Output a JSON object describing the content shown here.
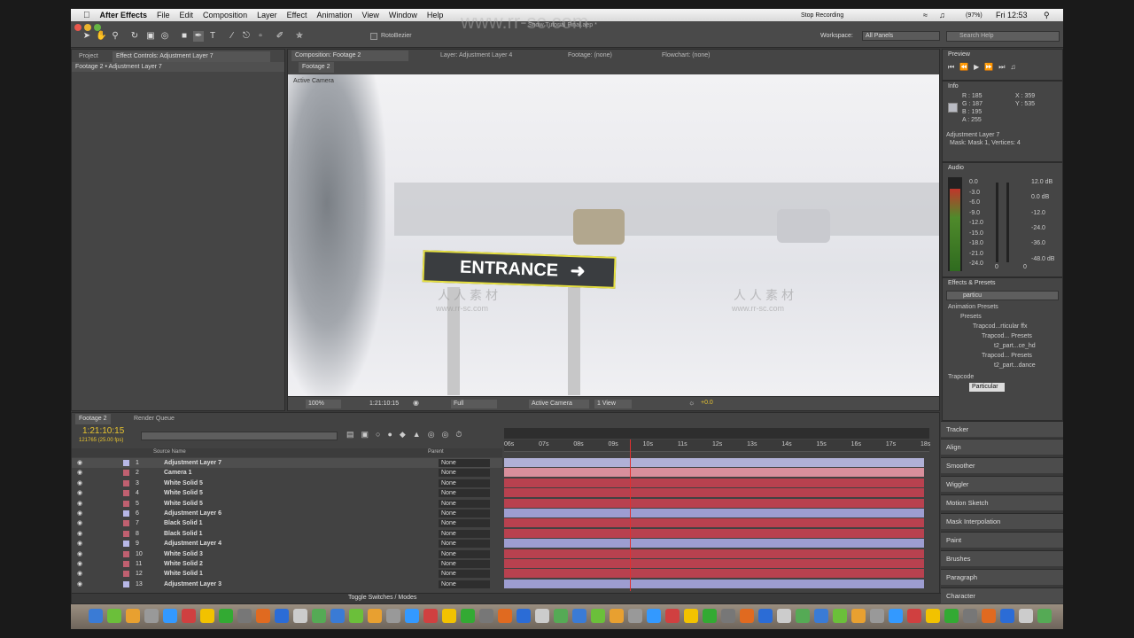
{
  "menubar": {
    "app": "After Effects",
    "items": [
      "File",
      "Edit",
      "Composition",
      "Layer",
      "Effect",
      "Animation",
      "View",
      "Window",
      "Help"
    ],
    "recording": "Stop Recording",
    "battery": "(97%)",
    "time": "Fri 12:53"
  },
  "window_title": "Snow Tutorial Final.aep *",
  "toolbar": {
    "rotobezier": "RotoBezier",
    "workspace_label": "Workspace:",
    "workspace_value": "All Panels",
    "search_placeholder": "Search Help"
  },
  "left_panel": {
    "tab_project": "Project",
    "tab_effect_controls": "Effect Controls: Adjustment Layer 7",
    "breadcrumb": "Footage 2 • Adjustment Layer 7"
  },
  "viewer": {
    "tab_composition": "Composition: Footage 2",
    "tab_layer": "Layer: Adjustment Layer 4",
    "tab_footage": "Footage: (none)",
    "tab_flowchart": "Flowchart: (none)",
    "subtab": "Footage 2",
    "camera_label": "Active Camera",
    "sign_text": "ENTRANCE",
    "zoom": "100%",
    "timecode": "1:21:10:15",
    "resolution": "Full",
    "camera_select": "Active Camera",
    "views": "1 View",
    "exposure": "+0.0"
  },
  "preview": {
    "title": "Preview"
  },
  "info": {
    "title": "Info",
    "r": "R : 185",
    "g": "G : 187",
    "b": "B : 195",
    "a": "A : 255",
    "x": "X : 359",
    "y": "Y : 535",
    "layer": "Adjustment Layer 7",
    "mask": "Mask: Mask 1, Vertices: 4"
  },
  "audio": {
    "title": "Audio",
    "left_scale": [
      "0.0",
      "-3.0",
      "-6.0",
      "-9.0",
      "-12.0",
      "-15.0",
      "-18.0",
      "-21.0",
      "-24.0"
    ],
    "right_scale": [
      "12.0 dB",
      "0.0 dB",
      "-12.0",
      "-24.0",
      "-36.0",
      "-48.0 dB"
    ],
    "knob_left": "0",
    "knob_right": "0",
    "meter_level": 0.88
  },
  "effects_presets": {
    "title": "Effects & Presets",
    "search": "particu",
    "tree": [
      "Animation Presets",
      "Presets",
      "Trapcod...rticular ffx",
      "Trapcod... Presets",
      "t2_part...ce_hd",
      "Trapcod... Presets",
      "t2_part...dance",
      "Trapcode",
      "Particular"
    ]
  },
  "right_panels": [
    "Tracker",
    "Align",
    "Smoother",
    "Wiggler",
    "Motion Sketch",
    "Mask Interpolation",
    "Paint",
    "Brushes",
    "Paragraph",
    "Character"
  ],
  "timeline": {
    "tab_comp": "Footage 2",
    "tab_render": "Render Queue",
    "timecode": "1:21:10:15",
    "frames": "121765 (25.00 fps)",
    "col_source": "Source Name",
    "col_parent": "Parent",
    "ruler": [
      "06s",
      "07s",
      "08s",
      "09s",
      "10s",
      "11s",
      "12s",
      "13s",
      "14s",
      "15s",
      "16s",
      "17s",
      "18s"
    ],
    "playhead": 0.295,
    "toggle": "Toggle Switches / Modes",
    "layers": [
      {
        "num": "1",
        "name": "Adjustment Layer 7",
        "parent": "None",
        "color": "#b7b7e6",
        "bar": "#b0b0d6"
      },
      {
        "num": "2",
        "name": "Camera 1",
        "parent": "None",
        "color": "#c06070",
        "bar": "#d88f9c"
      },
      {
        "num": "3",
        "name": "White Solid 5",
        "parent": "None",
        "color": "#c06070",
        "bar": "#b8414f"
      },
      {
        "num": "4",
        "name": "White Solid 5",
        "parent": "None",
        "color": "#c06070",
        "bar": "#b8414f"
      },
      {
        "num": "5",
        "name": "White Solid 5",
        "parent": "None",
        "color": "#c06070",
        "bar": "#b8414f"
      },
      {
        "num": "6",
        "name": "Adjustment Layer 6",
        "parent": "None",
        "color": "#b7b7e6",
        "bar": "#9d9dd1"
      },
      {
        "num": "7",
        "name": "Black Solid 1",
        "parent": "None",
        "color": "#c06070",
        "bar": "#b8414f"
      },
      {
        "num": "8",
        "name": "Black Solid 1",
        "parent": "None",
        "color": "#c06070",
        "bar": "#b8414f"
      },
      {
        "num": "9",
        "name": "Adjustment Layer 4",
        "parent": "None",
        "color": "#b7b7e6",
        "bar": "#9d9dd1"
      },
      {
        "num": "10",
        "name": "White Solid 3",
        "parent": "None",
        "color": "#c06070",
        "bar": "#b8414f"
      },
      {
        "num": "11",
        "name": "White Solid 2",
        "parent": "None",
        "color": "#c06070",
        "bar": "#b8414f"
      },
      {
        "num": "12",
        "name": "White Solid 1",
        "parent": "None",
        "color": "#c06070",
        "bar": "#b8414f"
      },
      {
        "num": "13",
        "name": "Adjustment Layer 3",
        "parent": "None",
        "color": "#b7b7e6",
        "bar": "#9d9dd1"
      }
    ]
  },
  "watermark": {
    "url": "www.rr-sc.com",
    "cn": "人人素材"
  }
}
